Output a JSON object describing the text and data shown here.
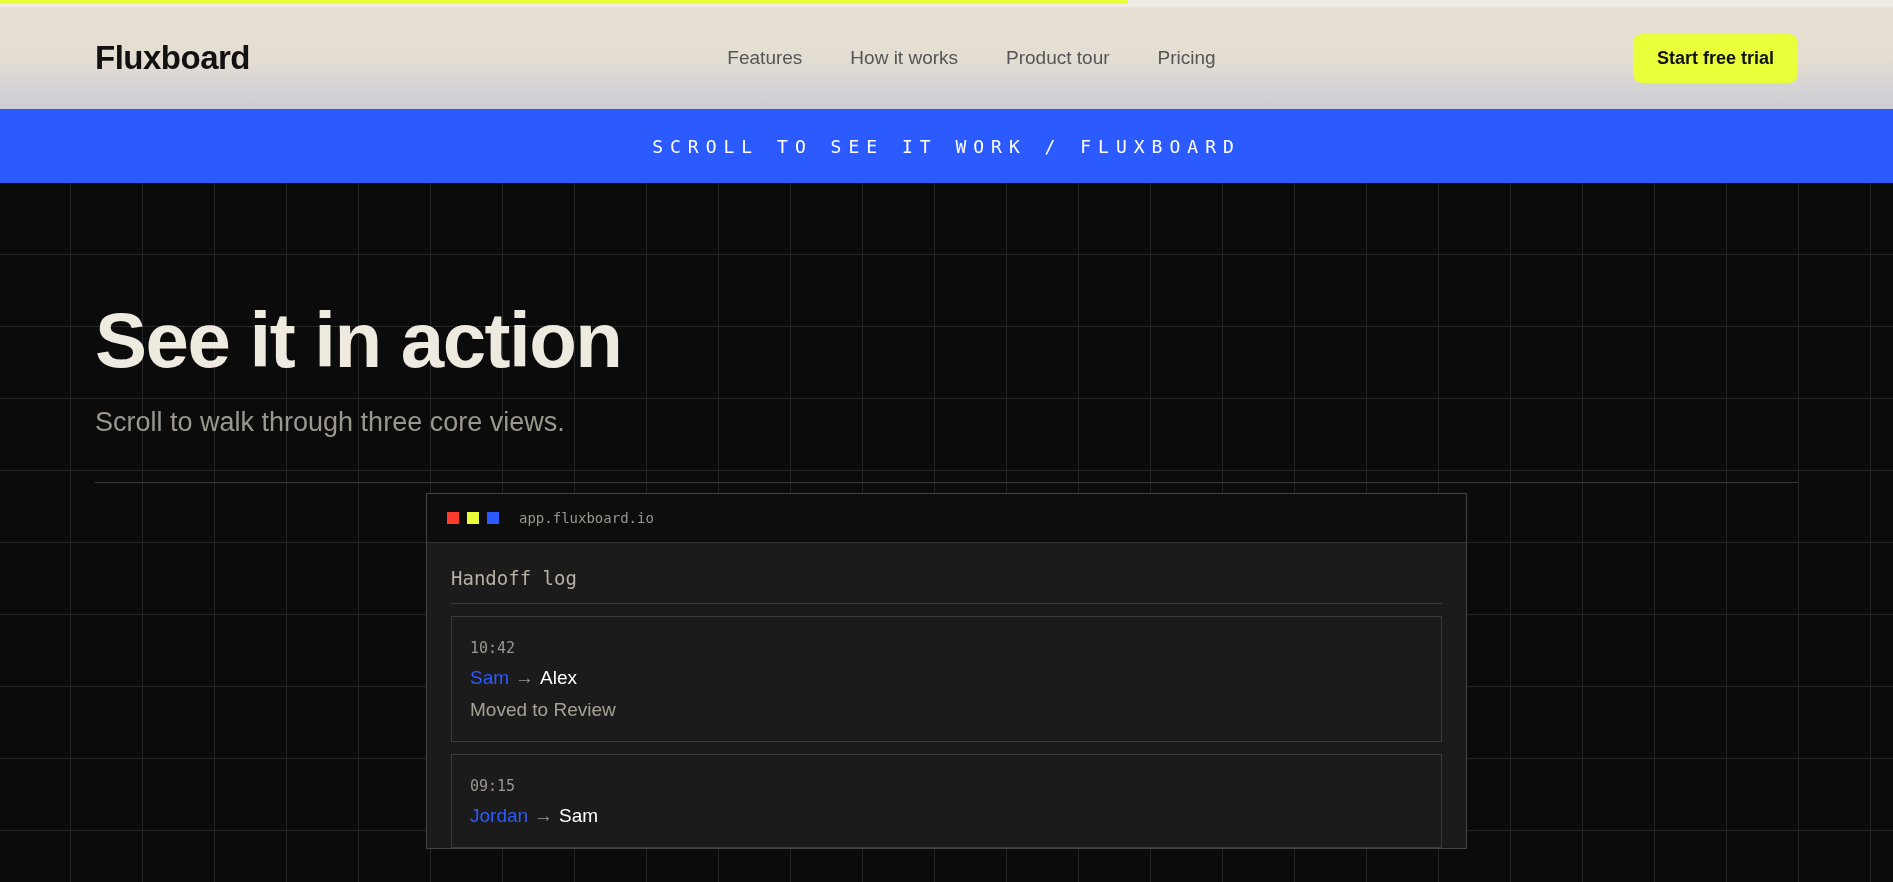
{
  "scroll_progress": {
    "level": 0.596
  },
  "nav": {
    "logo": "Fluxboard",
    "links": [
      "Features",
      "How it works",
      "Product tour",
      "Pricing"
    ],
    "cta": "Start free trial"
  },
  "banner": "SCROLL TO SEE IT WORK / FLUXBOARD",
  "hero": {
    "title": "See it in action",
    "subtitle": "Scroll to walk through three core views."
  },
  "app_window": {
    "dots": [
      {
        "color": "#ff3b2f"
      },
      {
        "color": "#e8ff3a"
      },
      {
        "color": "#2b5bff"
      }
    ],
    "url": "app.fluxboard.io",
    "heading": "Handoff log",
    "entries": [
      {
        "time": "10:42",
        "from": "Sam",
        "arrow": "→",
        "to": "Alex",
        "note": "Moved to Review"
      },
      {
        "time": "09:15",
        "from": "Jordan",
        "arrow": "→",
        "to": "Sam"
      }
    ]
  }
}
